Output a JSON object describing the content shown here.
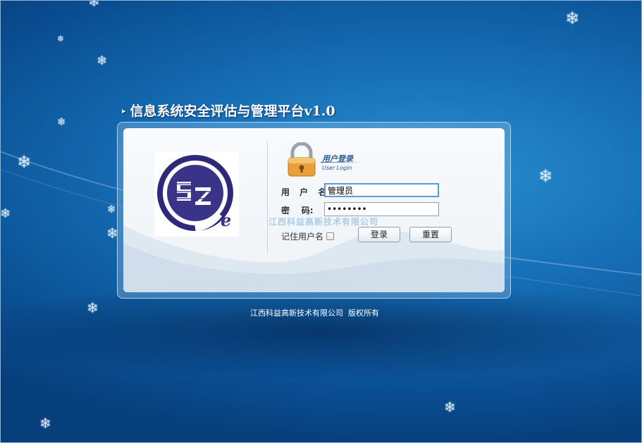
{
  "app": {
    "title": "信息系统安全评估与管理平台v1.0",
    "title_marker": "▸"
  },
  "login": {
    "header_cn": "用户登录",
    "header_en": "User Login",
    "username_label": "用 户 名:",
    "password_label": "密    码:",
    "username_value": "管理员",
    "password_value": "••••••••",
    "remember_label": "记住用户名",
    "remember_checked": false,
    "login_button": "登录",
    "reset_button": "重置",
    "watermark": "江西科益高新技术有限公司"
  },
  "logo": {
    "letters": "SZ",
    "sub_letter": "e"
  },
  "footer": {
    "copyright": "江西科益高新技术有限公司  版权所有"
  },
  "icons": {
    "snowflake": "snowflake-icon",
    "lock": "lock-icon"
  },
  "colors": {
    "background": "#156cb3",
    "accent": "#2a5a9a",
    "logo_ring": "#2e2a7a"
  }
}
